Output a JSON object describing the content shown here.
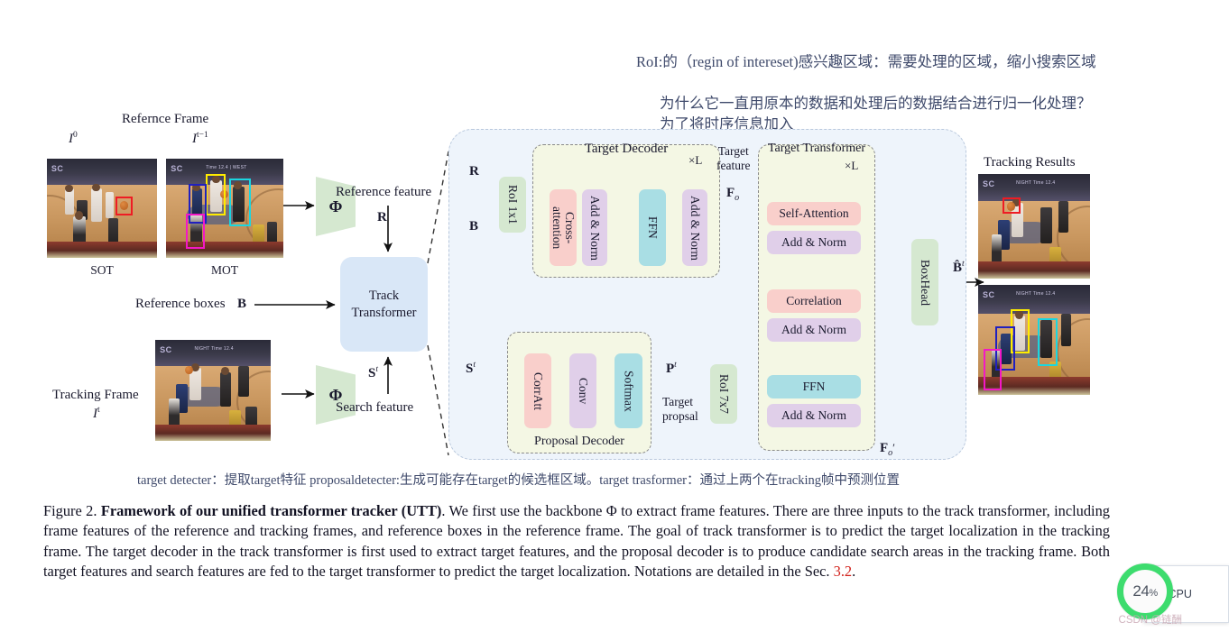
{
  "annotations": {
    "roi_note": "RoI:的（regin of intereset)感兴趣区域：需要处理的区域，缩小搜索区域",
    "question_line1": "为什么它一直用原本的数据和处理后的数据结合进行归一化处理？",
    "question_line2": "为了将时序信息加入",
    "bottom_note": "target detecter：提取target特征  proposaldetecter:生成可能存在target的候选框区域。target trasformer：通过上两个在tracking帧中预测位置"
  },
  "figure": {
    "reference_frame_title": "Refernce Frame",
    "frame_i0_label": "I⁰",
    "frame_it1_label": "I^{t-1}",
    "sot_label": "SOT",
    "mot_label": "MOT",
    "tracking_frame_label": "Tracking Frame",
    "frame_it_label": "Iᵗ",
    "reference_feature_label": "Reference feature",
    "search_feature_label": "Search feature",
    "reference_boxes_label": "Reference boxes",
    "tracking_results_label": "Tracking Results",
    "backbone_symbol": "Φ",
    "track_transformer_line1": "Track",
    "track_transformer_line2": "Transformer",
    "target_decoder_label": "Target Decoder",
    "proposal_decoder_label": "Proposal Decoder",
    "target_transformer_label": "Target Transformer",
    "target_feature_line1": "Target",
    "target_feature_line2": "feature",
    "target_proposal_line1": "Target",
    "target_proposal_line2": "propsal",
    "repeat_label": "×L",
    "blocks": {
      "roi_1x1": "RoI 1x1",
      "roi_7x7": "RoI 7x7",
      "cross_attention": "Cross-\nattention",
      "add_norm": "Add & Norm",
      "ffn": "FFN",
      "corratt": "CorrAtt",
      "conv": "Conv",
      "softmax": "Softmax",
      "self_attention": "Self-Attention",
      "correlation": "Correlation",
      "boxhead": "BoxHead"
    },
    "symbols": {
      "R": "R",
      "B": "B",
      "S_t": "Sᵗ",
      "P_t": "Pᵗ",
      "F_o": "F_o",
      "F_o_prime": "F′_o",
      "B_hat_t": "B̂ᵗ"
    }
  },
  "caption": {
    "figure_number": "Figure 2.",
    "bold_title": "Framework of our unified transformer tracker (UTT)",
    "body_part1": ". We first use the backbone Φ to extract frame features. There are three inputs to the track transformer, including frame features of the reference and tracking frames, and reference boxes in the reference frame. The goal of track transformer is to predict the target localization in the tracking frame. The target decoder in the track transformer is first used to extract target features, and the proposal decoder is to produce candidate search areas in the tracking frame. Both target features and search features are fed to the target transformer to predict the target localization. Notations are detailed in the Sec. ",
    "section_ref": "3.2",
    "body_part2": "."
  },
  "cpu_widget": {
    "percent": "24",
    "percent_symbol": "%",
    "cpu_label": "CPU",
    "arrow": "↑",
    "watermark": "CSDN @链酬",
    "gauge_color": "#3ddc6e"
  }
}
